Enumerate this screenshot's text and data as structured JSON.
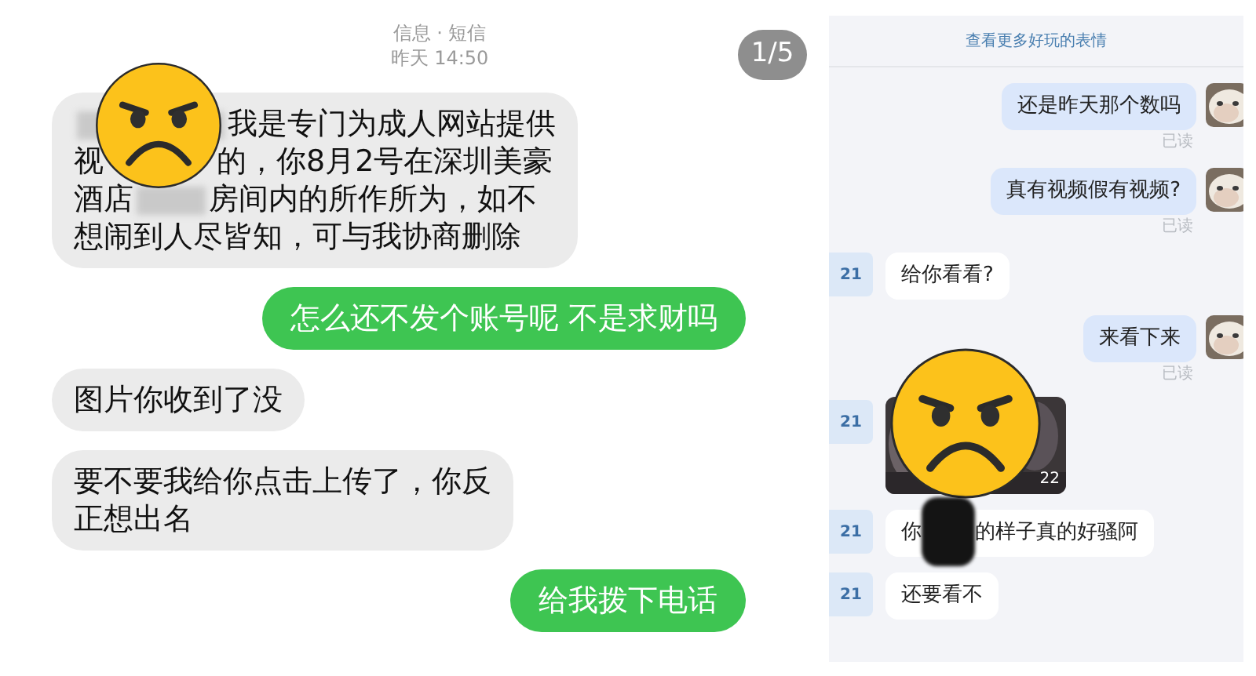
{
  "left": {
    "header": {
      "title": "信息 · 短信",
      "time": "昨天 14:50"
    },
    "page_badge": "1/5",
    "messages": [
      {
        "outgoing": false,
        "covered": true,
        "lines": [
          [
            {
              "kind": "blur_wide"
            },
            {
              "kind": "text",
              "text": "我是专门为成人网站提供"
            }
          ],
          [
            {
              "kind": "text",
              "text": "视"
            },
            {
              "kind": "gap"
            },
            {
              "kind": "text",
              "text": "的，你8月2号在深圳美豪"
            }
          ],
          [
            {
              "kind": "text",
              "text": "酒店"
            },
            {
              "kind": "blur_narrow"
            },
            {
              "kind": "text",
              "text": "房间内的所作所为，如不"
            }
          ],
          [
            {
              "kind": "text",
              "text": "想闹到人尽皆知，可与我协商删除"
            }
          ]
        ]
      },
      {
        "outgoing": true,
        "covered": false,
        "lines": [
          [
            {
              "kind": "text",
              "text": "怎么还不发个账号呢 不是求财吗"
            }
          ]
        ]
      },
      {
        "outgoing": false,
        "covered": false,
        "lines": [
          [
            {
              "kind": "text",
              "text": "图片你收到了没"
            }
          ]
        ]
      },
      {
        "outgoing": false,
        "covered": false,
        "lines": [
          [
            {
              "kind": "text",
              "text": "要不要我给你点击上传了，你反"
            }
          ],
          [
            {
              "kind": "text",
              "text": "正想出名"
            }
          ]
        ]
      },
      {
        "outgoing": true,
        "covered": false,
        "lines": [
          [
            {
              "kind": "text",
              "text": "给我拨下电话"
            }
          ]
        ]
      }
    ]
  },
  "right": {
    "top_link": "查看更多好玩的表情",
    "messages": [
      {
        "outgoing": true,
        "kind": "text",
        "parts": [
          {
            "kind": "text",
            "text": "还是昨天那个数吗"
          }
        ],
        "read_label": "已读"
      },
      {
        "outgoing": true,
        "kind": "text",
        "parts": [
          {
            "kind": "text",
            "text": "真有视频假有视频?"
          }
        ],
        "read_label": "已读"
      },
      {
        "outgoing": false,
        "kind": "text",
        "badge": "21",
        "parts": [
          {
            "kind": "text",
            "text": "给你看看?"
          }
        ]
      },
      {
        "outgoing": true,
        "kind": "text",
        "parts": [
          {
            "kind": "text",
            "text": "来看下来"
          }
        ],
        "read_label": "已读"
      },
      {
        "outgoing": false,
        "badge": "21",
        "caption": "22",
        "covered": true
      },
      {
        "outgoing": false,
        "kind": "text",
        "badge": "21",
        "parts": [
          {
            "kind": "text",
            "text": "你"
          },
          {
            "kind": "ink"
          },
          {
            "kind": "text",
            "text": "的样子真的好骚阿"
          }
        ]
      },
      {
        "outgoing": false,
        "kind": "text",
        "badge": "21",
        "parts": [
          {
            "kind": "text",
            "text": "还要看不"
          }
        ]
      }
    ]
  }
}
